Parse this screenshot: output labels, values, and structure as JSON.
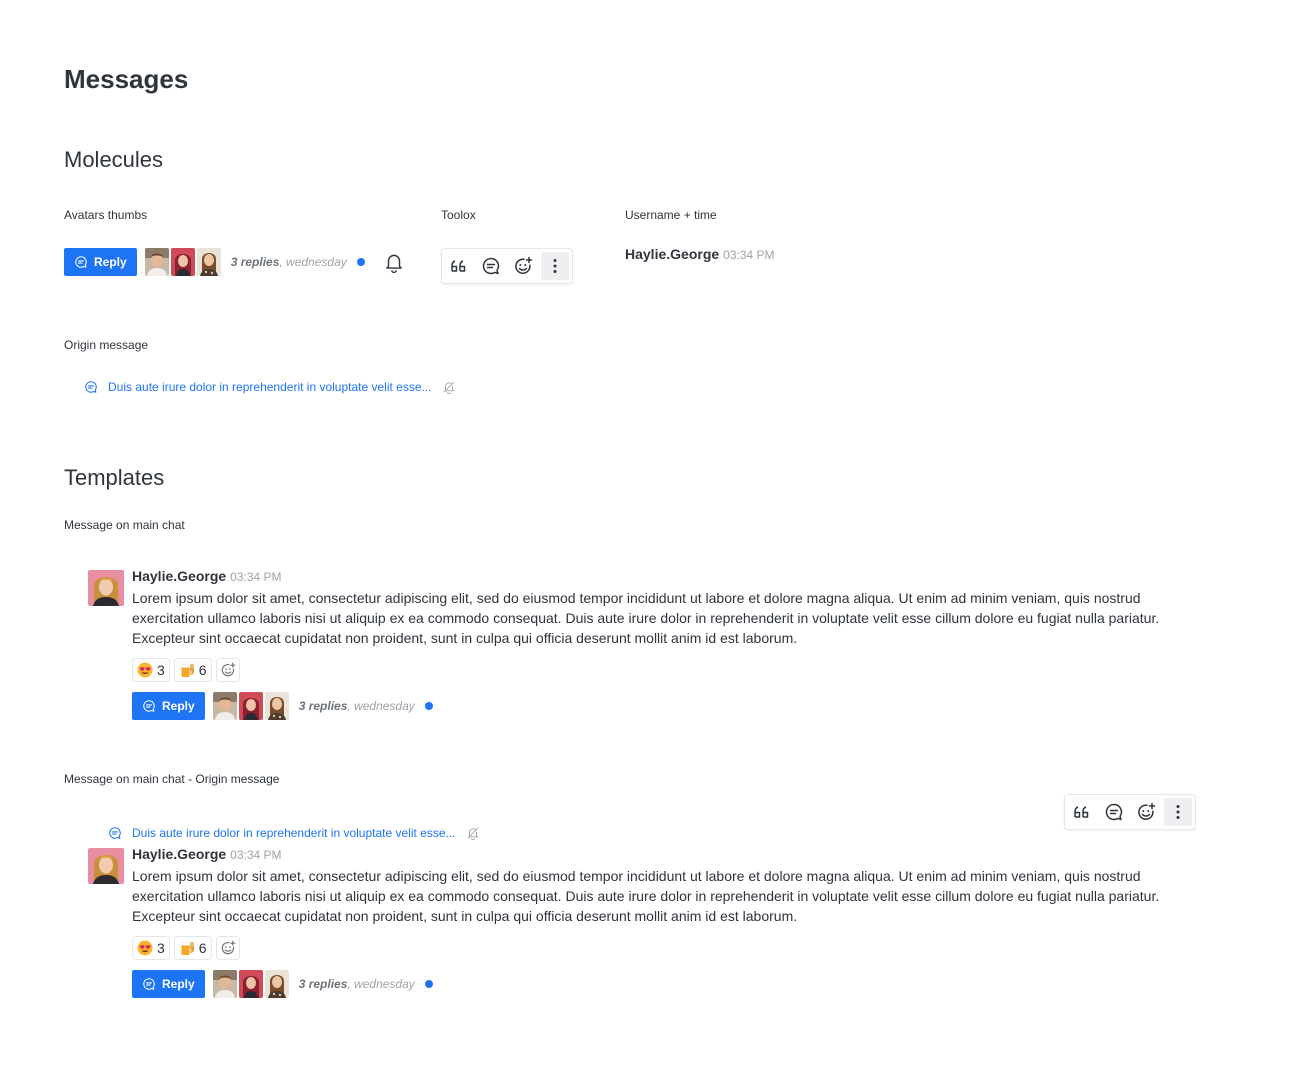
{
  "page_title": "Messages",
  "molecules": {
    "heading": "Molecules",
    "avatars_thumbs": {
      "caption": "Avatars thumbs",
      "reply_label": "Reply",
      "replies_count": "3 replies",
      "replies_day": ", wednesday"
    },
    "toolbox": {
      "caption": "Toolox",
      "icons": [
        "quote-icon",
        "reply-in-thread-icon",
        "add-reaction-icon",
        "kebab-menu-icon"
      ]
    },
    "username_time": {
      "caption": "Username + time",
      "username": "Haylie.George",
      "time": "03:34 PM"
    },
    "origin_message": {
      "caption": "Origin message",
      "text": "Duis aute irure dolor in reprehenderit in voluptate velit esse..."
    }
  },
  "templates": {
    "heading": "Templates",
    "main_chat": {
      "caption": "Message on main chat",
      "username": "Haylie.George",
      "time": "03:34 PM",
      "body": "Lorem ipsum dolor sit amet, consectetur adipiscing elit, sed do eiusmod tempor incididunt ut labore et dolore magna aliqua. Ut enim ad minim veniam, quis nostrud exercitation ullamco laboris nisi ut aliquip ex ea commodo consequat. Duis aute irure dolor in reprehenderit in voluptate velit esse cillum dolore eu fugiat nulla pariatur. Excepteur sint occaecat cupidatat non proident, sunt in culpa qui officia deserunt mollit anim id est laborum.",
      "reactions": [
        {
          "emoji": "heart-eyes-emoji",
          "count": "3"
        },
        {
          "emoji": "beer-mug-emoji",
          "count": "6"
        }
      ],
      "reply_label": "Reply",
      "replies_count": "3 replies",
      "replies_day": ", wednesday"
    },
    "main_chat_origin": {
      "caption": "Message on main chat - Origin message",
      "origin_text": "Duis aute irure dolor in reprehenderit in voluptate velit esse...",
      "username": "Haylie.George",
      "time": "03:34 PM",
      "body": "Lorem ipsum dolor sit amet, consectetur adipiscing elit, sed do eiusmod tempor incididunt ut labore et dolore magna aliqua. Ut enim ad minim veniam, quis nostrud exercitation ullamco laboris nisi ut aliquip ex ea commodo consequat. Duis aute irure dolor in reprehenderit in voluptate velit esse cillum dolore eu fugiat nulla pariatur. Excepteur sint occaecat cupidatat non proident, sunt in culpa qui officia deserunt mollit anim id est laborum.",
      "reactions": [
        {
          "emoji": "heart-eyes-emoji",
          "count": "3"
        },
        {
          "emoji": "beer-mug-emoji",
          "count": "6"
        }
      ],
      "reply_label": "Reply",
      "replies_count": "3 replies",
      "replies_day": ", wednesday"
    }
  },
  "colors": {
    "primary": "#1d74f5",
    "text": "#2f343d",
    "muted": "#9ea2a8",
    "border": "#e4e7ea"
  }
}
